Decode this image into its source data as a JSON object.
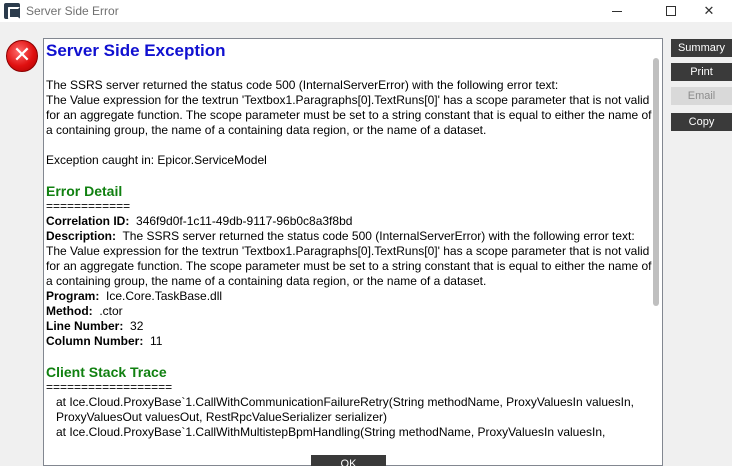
{
  "window": {
    "title": "Server Side Error",
    "minimize_glyph": "",
    "close_glyph": "✕"
  },
  "error_icon": {
    "glyph": "✕",
    "color": "#e01010"
  },
  "content": {
    "heading": "Server Side Exception",
    "intro_lines": [
      "The SSRS server returned the status code 500 (InternalServerError) with the following error text:",
      "The Value expression for the textrun 'Textbox1.Paragraphs[0].TextRuns[0]' has a scope parameter that is not valid for an aggregate function.  The scope parameter must be set to a string constant that is equal to either the name of a containing group, the name of a containing data region, or the name of a dataset."
    ],
    "exception_caught": "Exception caught in: Epicor.ServiceModel",
    "detail_heading": "Error Detail",
    "detail_divider": "============",
    "correlation_label": "Correlation ID:",
    "correlation_value": "346f9d0f-1c11-49db-9117-96b0c8a3f8bd",
    "description_label": "Description:",
    "description_value": "The SSRS server returned the status code 500 (InternalServerError) with the following error text:",
    "description_detail": "The Value expression for the textrun 'Textbox1.Paragraphs[0].TextRuns[0]' has a scope parameter that is not valid for an aggregate function.  The scope parameter must be set to a string constant that is equal to either the name of a containing group, the name of a containing data region, or the name of a dataset.",
    "program_label": "Program:",
    "program_value": "Ice.Core.TaskBase.dll",
    "method_label": "Method:",
    "method_value": ".ctor",
    "line_label": "Line Number:",
    "line_value": "32",
    "column_label": "Column Number:",
    "column_value": "11",
    "stack_heading": "Client Stack Trace",
    "stack_divider": "==================",
    "stack_lines": [
      "at Ice.Cloud.ProxyBase`1.CallWithCommunicationFailureRetry(String methodName, ProxyValuesIn valuesIn, ProxyValuesOut valuesOut, RestRpcValueSerializer serializer)",
      "at Ice.Cloud.ProxyBase`1.CallWithMultistepBpmHandling(String methodName, ProxyValuesIn valuesIn,"
    ]
  },
  "buttons": {
    "summary": "Summary",
    "print": "Print",
    "email": "Email",
    "copy": "Copy",
    "ok": "OK"
  },
  "colors": {
    "heading_blue": "#1010d0",
    "section_green": "#108010",
    "button_dark": "#3a3a3a",
    "button_disabled": "#d9d9d9"
  }
}
